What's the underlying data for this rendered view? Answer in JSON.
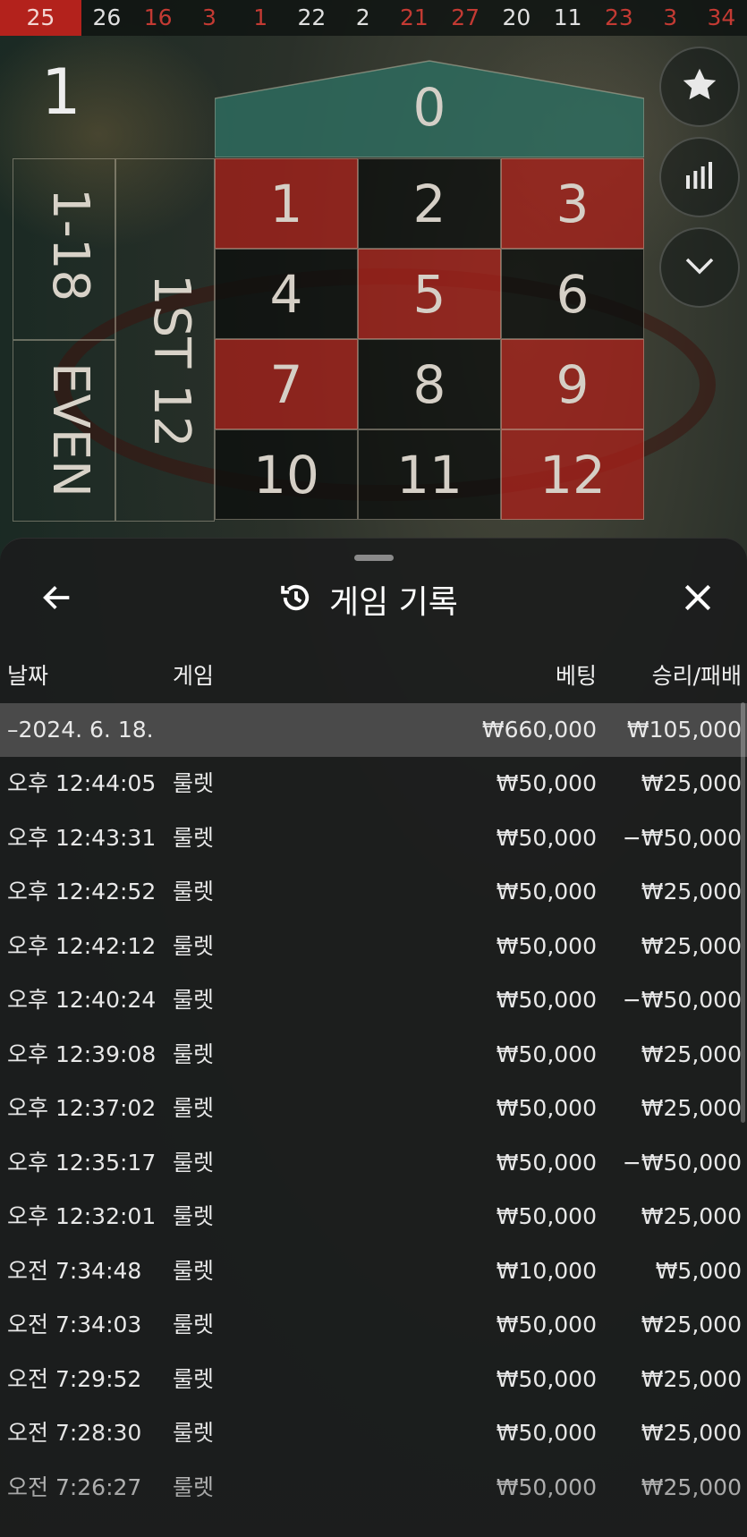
{
  "history_bar": [
    {
      "n": "25",
      "c": "first"
    },
    {
      "n": "26",
      "c": "black"
    },
    {
      "n": "16",
      "c": "red"
    },
    {
      "n": "3",
      "c": "red"
    },
    {
      "n": "1",
      "c": "red"
    },
    {
      "n": "22",
      "c": "black"
    },
    {
      "n": "2",
      "c": "black"
    },
    {
      "n": "21",
      "c": "red"
    },
    {
      "n": "27",
      "c": "red"
    },
    {
      "n": "20",
      "c": "black"
    },
    {
      "n": "11",
      "c": "black"
    },
    {
      "n": "23",
      "c": "red"
    },
    {
      "n": "3",
      "c": "red"
    },
    {
      "n": "34",
      "c": "red"
    }
  ],
  "round_label": "1",
  "table": {
    "zero": "0",
    "cells": [
      {
        "n": "1",
        "color": "red"
      },
      {
        "n": "2",
        "color": "black"
      },
      {
        "n": "3",
        "color": "red"
      },
      {
        "n": "4",
        "color": "black"
      },
      {
        "n": "5",
        "color": "red"
      },
      {
        "n": "6",
        "color": "black"
      },
      {
        "n": "7",
        "color": "red"
      },
      {
        "n": "8",
        "color": "black"
      },
      {
        "n": "9",
        "color": "red"
      },
      {
        "n": "10",
        "color": "black"
      },
      {
        "n": "11",
        "color": "black"
      },
      {
        "n": "12",
        "color": "red"
      }
    ],
    "bet_1_18": "1-18",
    "bet_even": "EVEN",
    "bet_1st12": "1ST 12"
  },
  "side_buttons": [
    "star-icon",
    "stats-icon",
    "chevron-down-icon"
  ],
  "sheet": {
    "title": "게임 기록",
    "columns": {
      "date": "날짜",
      "game": "게임",
      "bet": "베팅",
      "winloss": "승리/패배"
    },
    "summary": {
      "date": "–2024. 6. 18.",
      "bet": "₩660,000",
      "winloss": "₩105,000"
    },
    "rows": [
      {
        "time": "오후 12:44:05",
        "game": "룰렛",
        "bet": "₩50,000",
        "winloss": "₩25,000"
      },
      {
        "time": "오후 12:43:31",
        "game": "룰렛",
        "bet": "₩50,000",
        "winloss": "−₩50,000"
      },
      {
        "time": "오후 12:42:52",
        "game": "룰렛",
        "bet": "₩50,000",
        "winloss": "₩25,000"
      },
      {
        "time": "오후 12:42:12",
        "game": "룰렛",
        "bet": "₩50,000",
        "winloss": "₩25,000"
      },
      {
        "time": "오후 12:40:24",
        "game": "룰렛",
        "bet": "₩50,000",
        "winloss": "−₩50,000"
      },
      {
        "time": "오후 12:39:08",
        "game": "룰렛",
        "bet": "₩50,000",
        "winloss": "₩25,000"
      },
      {
        "time": "오후 12:37:02",
        "game": "룰렛",
        "bet": "₩50,000",
        "winloss": "₩25,000"
      },
      {
        "time": "오후 12:35:17",
        "game": "룰렛",
        "bet": "₩50,000",
        "winloss": "−₩50,000"
      },
      {
        "time": "오후 12:32:01",
        "game": "룰렛",
        "bet": "₩50,000",
        "winloss": "₩25,000"
      },
      {
        "time": "오전 7:34:48",
        "game": "룰렛",
        "bet": "₩10,000",
        "winloss": "₩5,000"
      },
      {
        "time": "오전 7:34:03",
        "game": "룰렛",
        "bet": "₩50,000",
        "winloss": "₩25,000"
      },
      {
        "time": "오전 7:29:52",
        "game": "룰렛",
        "bet": "₩50,000",
        "winloss": "₩25,000"
      },
      {
        "time": "오전 7:28:30",
        "game": "룰렛",
        "bet": "₩50,000",
        "winloss": "₩25,000"
      },
      {
        "time": "오전 7:26:27",
        "game": "룰렛",
        "bet": "₩50,000",
        "winloss": "₩25,000"
      }
    ]
  },
  "colors": {
    "red": "#b3221c",
    "zero_green": "#2e6b5e",
    "sheet_bg": "#1c1d1d"
  }
}
